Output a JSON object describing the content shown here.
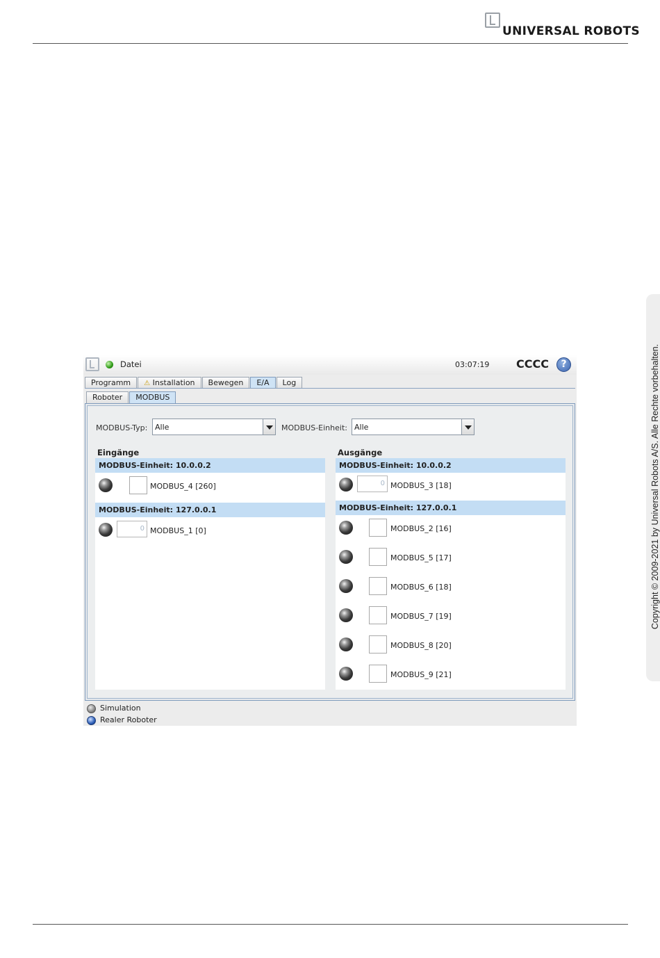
{
  "brand": {
    "name": "UNIVERSAL ROBOTS"
  },
  "copyright": "Copyright © 2009-2021 by Universal Robots A/S. Alle Rechte vorbehalten.",
  "app": {
    "file_menu": "Datei",
    "time": "03:07:19",
    "robot_name": "CCCC",
    "help": "?",
    "tabs": [
      "Programm",
      "Installation",
      "Bewegen",
      "E/A",
      "Log"
    ],
    "active_tab": "E/A",
    "subtabs": [
      "Roboter",
      "MODBUS"
    ],
    "active_subtab": "MODBUS",
    "filters": {
      "type_label": "MODBUS-Typ:",
      "type_value": "Alle",
      "unit_label": "MODBUS-Einheit:",
      "unit_value": "Alle"
    },
    "inputs": {
      "title": "Eingänge",
      "groups": [
        {
          "header": "MODBUS-Einheit: 10.0.0.2",
          "items": [
            {
              "label": "MODBUS_4 [260]",
              "kind": "checkbox"
            }
          ]
        },
        {
          "header": "MODBUS-Einheit: 127.0.0.1",
          "items": [
            {
              "label": "MODBUS_1 [0]",
              "kind": "register",
              "value": "0"
            }
          ]
        }
      ]
    },
    "outputs": {
      "title": "Ausgänge",
      "groups": [
        {
          "header": "MODBUS-Einheit: 10.0.0.2",
          "items": [
            {
              "label": "MODBUS_3 [18]",
              "kind": "register",
              "value": "0"
            }
          ]
        },
        {
          "header": "MODBUS-Einheit: 127.0.0.1",
          "items": [
            {
              "label": "MODBUS_2 [16]",
              "kind": "checkbox"
            },
            {
              "label": "MODBUS_5 [17]",
              "kind": "checkbox"
            },
            {
              "label": "MODBUS_6 [18]",
              "kind": "checkbox"
            },
            {
              "label": "MODBUS_7 [19]",
              "kind": "checkbox"
            },
            {
              "label": "MODBUS_8 [20]",
              "kind": "checkbox"
            },
            {
              "label": "MODBUS_9 [21]",
              "kind": "checkbox"
            }
          ]
        }
      ]
    },
    "legend": {
      "simulation": "Simulation",
      "real_robot": "Realer Roboter"
    }
  },
  "colors": {
    "accent": "#c3ddf4",
    "status_ok": "#2e9a16",
    "help": "#3a64b0"
  }
}
